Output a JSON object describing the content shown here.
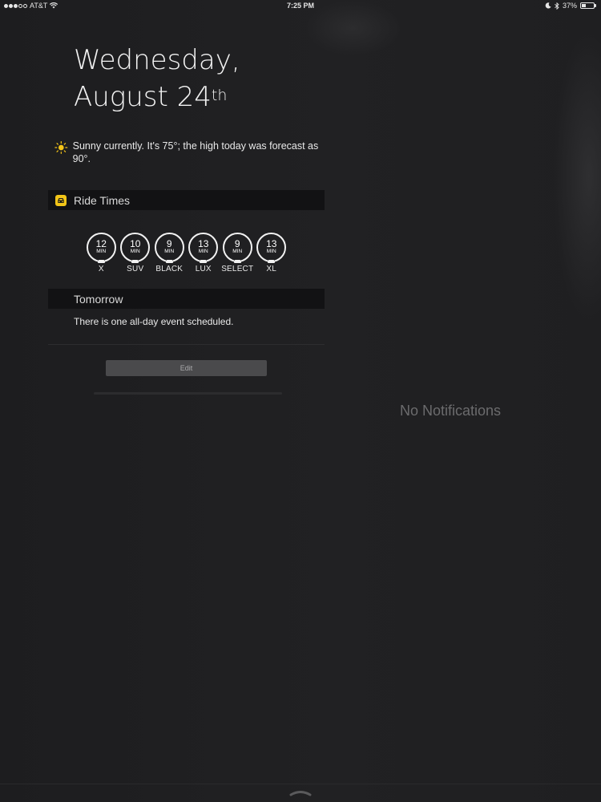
{
  "status_bar": {
    "carrier": "AT&T",
    "signal_bars": 3,
    "time": "7:25 PM",
    "battery": "37%",
    "battery_level": 0.37
  },
  "today": {
    "weekday_line": "Wednesday,",
    "date_line": "August 24",
    "date_suffix": "th",
    "weather_text": "Sunny currently. It's 75°; the high today was forecast as 90°."
  },
  "ride_widget": {
    "title": "Ride Times",
    "rides": [
      {
        "minutes": "12",
        "unit": "MIN",
        "label": "X"
      },
      {
        "minutes": "10",
        "unit": "MIN",
        "label": "SUV"
      },
      {
        "minutes": "9",
        "unit": "MIN",
        "label": "BLACK"
      },
      {
        "minutes": "13",
        "unit": "MIN",
        "label": "LUX"
      },
      {
        "minutes": "9",
        "unit": "MIN",
        "label": "SELECT"
      },
      {
        "minutes": "13",
        "unit": "MIN",
        "label": "XL"
      }
    ]
  },
  "calendar_widget": {
    "title": "Tomorrow",
    "text": "There is one all-day event scheduled."
  },
  "edit_label": "Edit",
  "notifications": {
    "empty_text": "No Notifications"
  },
  "colors": {
    "background": "#1e1e20",
    "header_bar": "#121214",
    "app_icon": "#f2c518",
    "sun": "#f5c518"
  }
}
